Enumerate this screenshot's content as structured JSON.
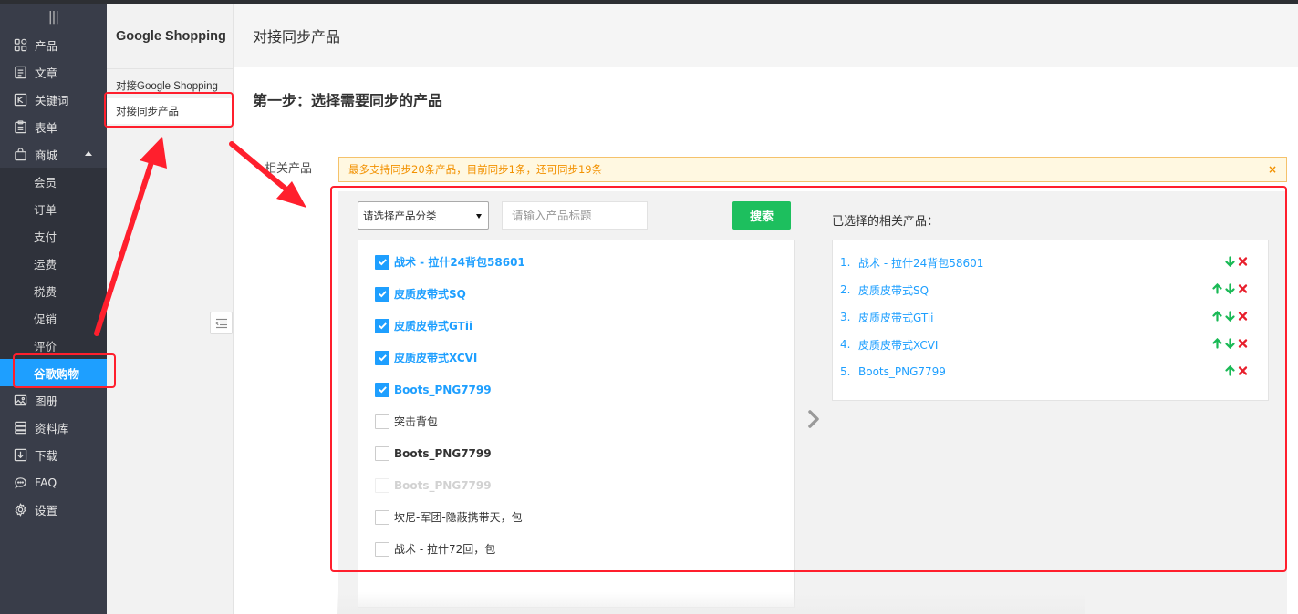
{
  "nav": {
    "toggle": "|||",
    "items": [
      {
        "label": "产品",
        "icon": "grid-icon"
      },
      {
        "label": "文章",
        "icon": "article-icon"
      },
      {
        "label": "关键词",
        "icon": "keyword-icon"
      },
      {
        "label": "表单",
        "icon": "form-icon"
      },
      {
        "label": "商城",
        "icon": "bag-icon"
      }
    ],
    "shop_sub": [
      "会员",
      "订单",
      "支付",
      "运费",
      "税费",
      "促销",
      "评价",
      "谷歌购物"
    ],
    "items_after": [
      {
        "label": "图册",
        "icon": "image-icon"
      },
      {
        "label": "资料库",
        "icon": "library-icon"
      },
      {
        "label": "下载",
        "icon": "download-icon"
      },
      {
        "label": "FAQ",
        "icon": "chat-icon"
      },
      {
        "label": "设置",
        "icon": "gear-icon"
      }
    ]
  },
  "subpanel": {
    "title": "Google Shopping",
    "links": [
      "对接Google Shopping",
      "对接同步产品"
    ]
  },
  "main": {
    "header": "对接同步产品",
    "step_title": "第一步：选择需要同步的产品",
    "field_label": "相关产品",
    "warning": "最多支持同步20条产品，目前同步1条，还可同步19条",
    "warning_close": "×"
  },
  "picker": {
    "category_select": "请选择产品分类",
    "title_placeholder": "请输入产品标题",
    "search_label": "搜索",
    "products": [
      {
        "name": "战术 - 拉什24背包58601",
        "checked": true
      },
      {
        "name": "皮质皮带式SQ",
        "checked": true
      },
      {
        "name": "皮质皮带式GTii",
        "checked": true
      },
      {
        "name": "皮质皮带式XCVI",
        "checked": true
      },
      {
        "name": "Boots_PNG7799",
        "checked": true
      },
      {
        "name": "突击背包",
        "checked": false
      },
      {
        "name": "Boots_PNG7799",
        "checked": false
      },
      {
        "name": "Boots_PNG7799",
        "checked": false,
        "disabled": true
      },
      {
        "name": "坎尼-军团-隐蔽携带天，包",
        "checked": false
      },
      {
        "name": "战术 - 拉什72回，包",
        "checked": false
      }
    ],
    "selected_title": "已选择的相关产品：",
    "selected": [
      {
        "num": "1.",
        "name": "战术 - 拉什24背包58601"
      },
      {
        "num": "2.",
        "name": "皮质皮带式SQ"
      },
      {
        "num": "3.",
        "name": "皮质皮带式GTii"
      },
      {
        "num": "4.",
        "name": "皮质皮带式XCVI"
      },
      {
        "num": "5.",
        "name": "Boots_PNG7799"
      }
    ]
  },
  "colors": {
    "nav_bg": "#393d49",
    "accent_blue": "#1e9fff",
    "search_green": "#1dbf5e",
    "warning_orange": "#f29100",
    "annotation_red": "#ff1f2d"
  }
}
